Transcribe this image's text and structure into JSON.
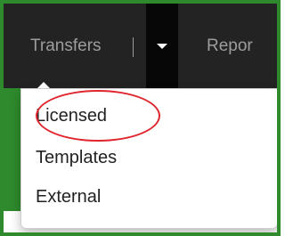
{
  "navbar": {
    "transfers_label": "Transfers",
    "reports_label": "Repor",
    "toggle_icon": "caret-down-icon"
  },
  "dropdown": {
    "items": [
      {
        "label": "Licensed"
      },
      {
        "label": "Templates"
      },
      {
        "label": "External"
      }
    ]
  },
  "colors": {
    "navbar_bg": "#232323",
    "nav_text": "#9d9d9d",
    "border_green": "#2e8a2c",
    "highlight_red": "#e0252d",
    "menu_text": "#222222"
  }
}
